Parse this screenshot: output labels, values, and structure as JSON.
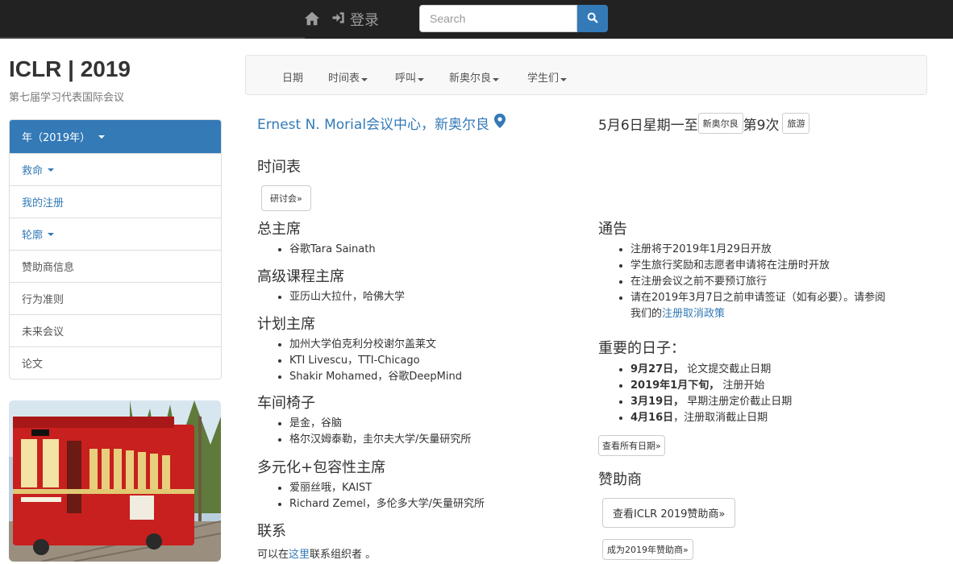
{
  "topbar": {
    "login_label": "登录",
    "search_placeholder": "Search"
  },
  "brand": {
    "title": "ICLR | 2019",
    "subtitle": "第七届学习代表国际会议"
  },
  "sidebar": {
    "items": [
      {
        "label": "年（2019年）"
      },
      {
        "label": "救命"
      },
      {
        "label": "我的注册"
      },
      {
        "label": "轮廓"
      },
      {
        "label": "赞助商信息"
      },
      {
        "label": "行为准则"
      },
      {
        "label": "未来会议"
      },
      {
        "label": "论文"
      }
    ]
  },
  "menu": {
    "items": [
      "日期",
      "时间表",
      "呼叫",
      "新奥尔良",
      "学生们"
    ]
  },
  "venue": {
    "text": "Ernest N. Morial会议中心，新奥尔良"
  },
  "dateline": {
    "part1": "5月6日星期一至",
    "tag1": "新奥尔良",
    "part2": "第9次",
    "tag2": "旅游"
  },
  "schedule": {
    "heading": "时间表",
    "workshop_button": "研讨会»"
  },
  "committee": {
    "general_chair": {
      "heading": "总主席",
      "members": [
        "谷歌Tara Sainath"
      ]
    },
    "senior_program": {
      "heading": "高级课程主席",
      "members": [
        "亚历山大拉什，哈佛大学"
      ]
    },
    "program_chairs": {
      "heading": "计划主席",
      "members": [
        "加州大学伯克利分校谢尔盖莱文",
        "KTI Livescu，TTI-Chicago",
        "Shakir Mohamed，谷歌DeepMind"
      ]
    },
    "workshop_chairs": {
      "heading": "车间椅子",
      "members": [
        "是金，谷脑",
        "格尔汉姆泰勒，圭尔夫大学/矢量研究所"
      ]
    },
    "diversity_chairs": {
      "heading": "多元化+包容性主席",
      "members": [
        "爱丽丝哦，KAIST",
        "Richard Zemel，多伦多大学/矢量研究所"
      ]
    },
    "contact": {
      "heading": "联系",
      "prefix": "可以在",
      "link": "这里",
      "suffix": "联系组织者 。"
    }
  },
  "announcements": {
    "heading": "通告",
    "items": [
      "注册将于2019年1月29日开放",
      "学生旅行奖励和志愿者申请将在注册时开放",
      " 在注册会议之前不要预订旅行",
      "请在2019年3月7日之前申请签证（如有必要）。请参阅"
    ],
    "last_line_prefix": "我们的",
    "last_line_link": "注册取消政策"
  },
  "important_dates": {
    "heading": "重要的日子：",
    "items": [
      {
        "date": "9月27日，",
        "text": " 论文提交截止日期"
      },
      {
        "date": "2019年1月下旬，",
        "text": " 注册开始"
      },
      {
        "date": "3月19日，",
        "text": " 早期注册定价截止日期"
      },
      {
        "date": "4月16日",
        "text": "，注册取消截止日期"
      }
    ],
    "all_dates_button": "查看所有日期»"
  },
  "sponsors": {
    "heading": "赞助商",
    "view_button": "查看ICLR 2019赞助商»",
    "become_button": "成为2019年赞助商»"
  }
}
